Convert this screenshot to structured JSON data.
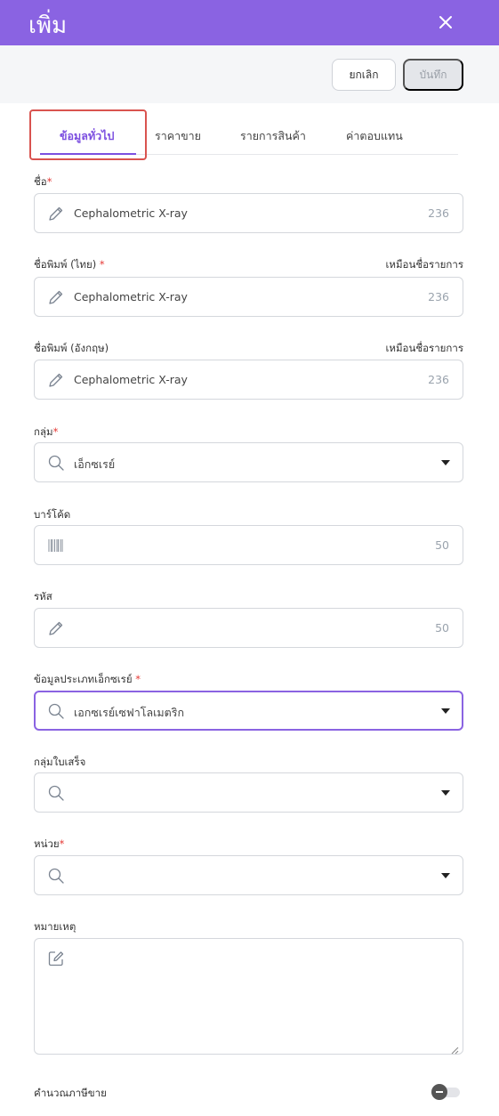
{
  "header": {
    "title": "เพิ่ม",
    "close_icon": "close-icon"
  },
  "toolbar": {
    "cancel_label": "ยกเลิก",
    "save_label": "บันทึก"
  },
  "tabs": [
    {
      "label": "ข้อมูลทั่วไป",
      "active": true
    },
    {
      "label": "ราคาขาย",
      "active": false
    },
    {
      "label": "รายการสินค้า",
      "active": false
    },
    {
      "label": "ค่าตอบแทน",
      "active": false
    }
  ],
  "form": {
    "required_mark": "*",
    "name": {
      "label": "ชื่อ",
      "value": "Cephalometric X-ray",
      "remaining": "236",
      "icon": "pencil-icon"
    },
    "print_name_th": {
      "label": "ชื่อพิมพ์ (ไทย)",
      "right_label": "เหมือนชื่อรายการ",
      "value": "Cephalometric X-ray",
      "remaining": "236",
      "icon": "pencil-icon"
    },
    "print_name_en": {
      "label": "ชื่อพิมพ์ (อังกฤษ)",
      "right_label": "เหมือนชื่อรายการ",
      "value": "Cephalometric X-ray",
      "remaining": "236",
      "icon": "pencil-icon"
    },
    "group": {
      "label": "กลุ่ม",
      "value": "เอ็กซเรย์",
      "icon": "search-icon"
    },
    "barcode": {
      "label": "บาร์โค้ด",
      "value": "",
      "remaining": "50",
      "icon": "barcode-icon"
    },
    "code": {
      "label": "รหัส",
      "value": "",
      "remaining": "50",
      "icon": "pencil-icon"
    },
    "xray_type": {
      "label": "ข้อมูลประเภทเอ็กซเรย์",
      "value": "เอกซเรย์เซฟาโลเมตริก",
      "icon": "search-icon"
    },
    "receipt_group": {
      "label": "กลุ่มใบเสร็จ",
      "value": "",
      "icon": "search-icon"
    },
    "unit": {
      "label": "หน่วย",
      "value": "",
      "icon": "search-icon"
    },
    "note": {
      "label": "หมายเหตุ",
      "value": "",
      "icon": "edit-icon"
    },
    "calc_tax": {
      "label": "คำนวณภาษีขาย",
      "enabled": false
    }
  },
  "colors": {
    "accent": "#8a63e2",
    "required": "#e53935",
    "highlight": "#d9534f"
  }
}
